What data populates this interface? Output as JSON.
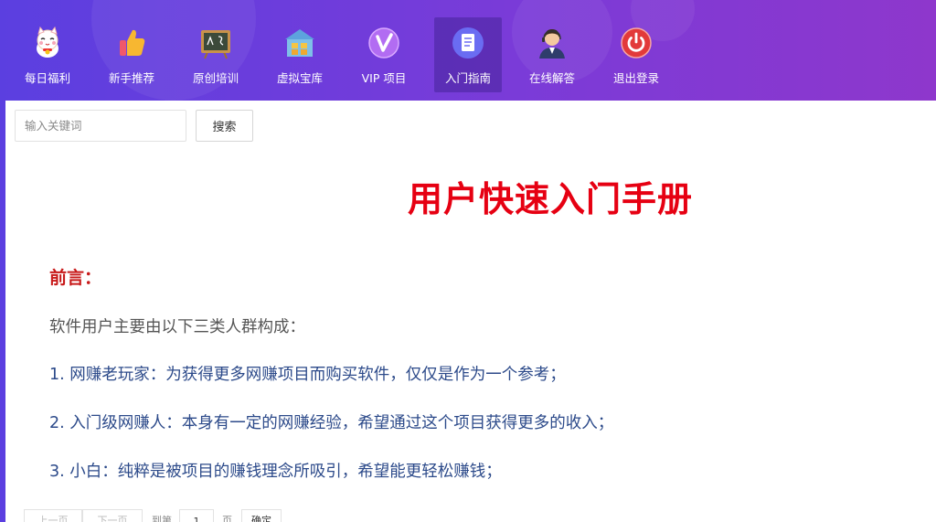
{
  "nav": {
    "items": [
      {
        "label": "每日福利",
        "icon": "lucky-cat-icon"
      },
      {
        "label": "新手推荐",
        "icon": "thumbs-up-icon"
      },
      {
        "label": "原创培训",
        "icon": "blackboard-icon"
      },
      {
        "label": "虚拟宝库",
        "icon": "treasure-house-icon"
      },
      {
        "label": "VIP 项目",
        "icon": "vip-icon"
      },
      {
        "label": "入门指南",
        "icon": "document-icon"
      },
      {
        "label": "在线解答",
        "icon": "support-agent-icon"
      },
      {
        "label": "退出登录",
        "icon": "power-icon"
      }
    ],
    "active_index": 5
  },
  "search": {
    "placeholder": "输入关键词",
    "button_label": "搜索"
  },
  "document": {
    "title": "用户快速入门手册",
    "preface_heading": "前言：",
    "intro": "软件用户主要由以下三类人群构成：",
    "items": [
      "1. 网赚老玩家：为获得更多网赚项目而购买软件，仅仅是作为一个参考；",
      "2. 入门级网赚人：本身有一定的网赚经验，希望通过这个项目获得更多的收入；",
      "3. 小白：纯粹是被项目的赚钱理念所吸引，希望能更轻松赚钱；"
    ]
  },
  "pagination": {
    "prev_label": "上一页",
    "next_label": "下一页",
    "goto_label": "到第",
    "page_value": "1",
    "page_unit": "页",
    "confirm_label": "确定"
  },
  "colors": {
    "header_gradient_start": "#5b3fe0",
    "header_gradient_end": "#8e37cc",
    "title_red": "#e60012",
    "preface_red": "#c81a1a",
    "item_blue": "#2c4a8a"
  }
}
